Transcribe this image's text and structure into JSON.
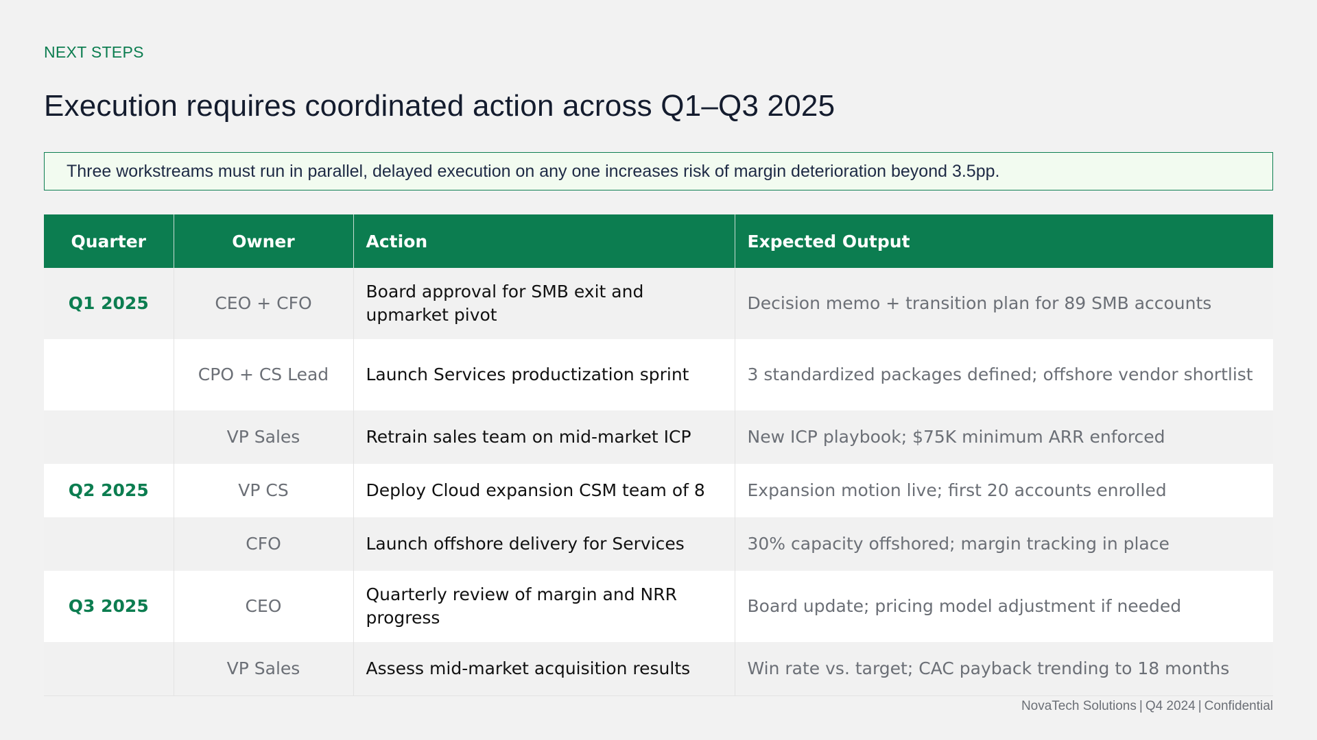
{
  "header": {
    "eyebrow": "NEXT STEPS",
    "title": "Execution requires coordinated action across Q1–Q3 2025"
  },
  "callout": {
    "text": "Three workstreams must run in parallel, delayed execution on any one increases risk of margin deterioration beyond 3.5pp."
  },
  "table": {
    "columns": [
      "Quarter",
      "Owner",
      "Action",
      "Expected Output"
    ],
    "rows": [
      {
        "quarter": "Q1 2025",
        "owner": "CEO + CFO",
        "action": "Board approval for SMB exit and upmarket pivot",
        "output": "Decision memo + transition plan for 89 SMB accounts"
      },
      {
        "quarter": "",
        "owner": "CPO + CS Lead",
        "action": "Launch Services productization sprint",
        "output": "3 standardized packages defined; offshore vendor shortlist"
      },
      {
        "quarter": "",
        "owner": "VP Sales",
        "action": "Retrain sales team on mid-market ICP",
        "output": "New ICP playbook; $75K minimum ARR enforced"
      },
      {
        "quarter": "Q2 2025",
        "owner": "VP CS",
        "action": "Deploy Cloud expansion CSM team of 8",
        "output": "Expansion motion live; first 20 accounts enrolled"
      },
      {
        "quarter": "",
        "owner": "CFO",
        "action": "Launch offshore delivery for Services",
        "output": "30% capacity offshored; margin tracking in place"
      },
      {
        "quarter": "Q3 2025",
        "owner": "CEO",
        "action": "Quarterly review of margin and NRR progress",
        "output": "Board update; pricing model adjustment if needed"
      },
      {
        "quarter": "",
        "owner": "VP Sales",
        "action": "Assess mid-market acquisition results",
        "output": "Win rate vs. target; CAC payback trending to 18 months"
      }
    ]
  },
  "footer": {
    "company": "NovaTech Solutions",
    "period": "Q4 2024",
    "classification": "Confidential",
    "separator": "|"
  },
  "colors": {
    "accent": "#0c7d50",
    "background": "#f2f2f2",
    "callout_bg": "#f2fbf0",
    "title": "#141c2e"
  }
}
